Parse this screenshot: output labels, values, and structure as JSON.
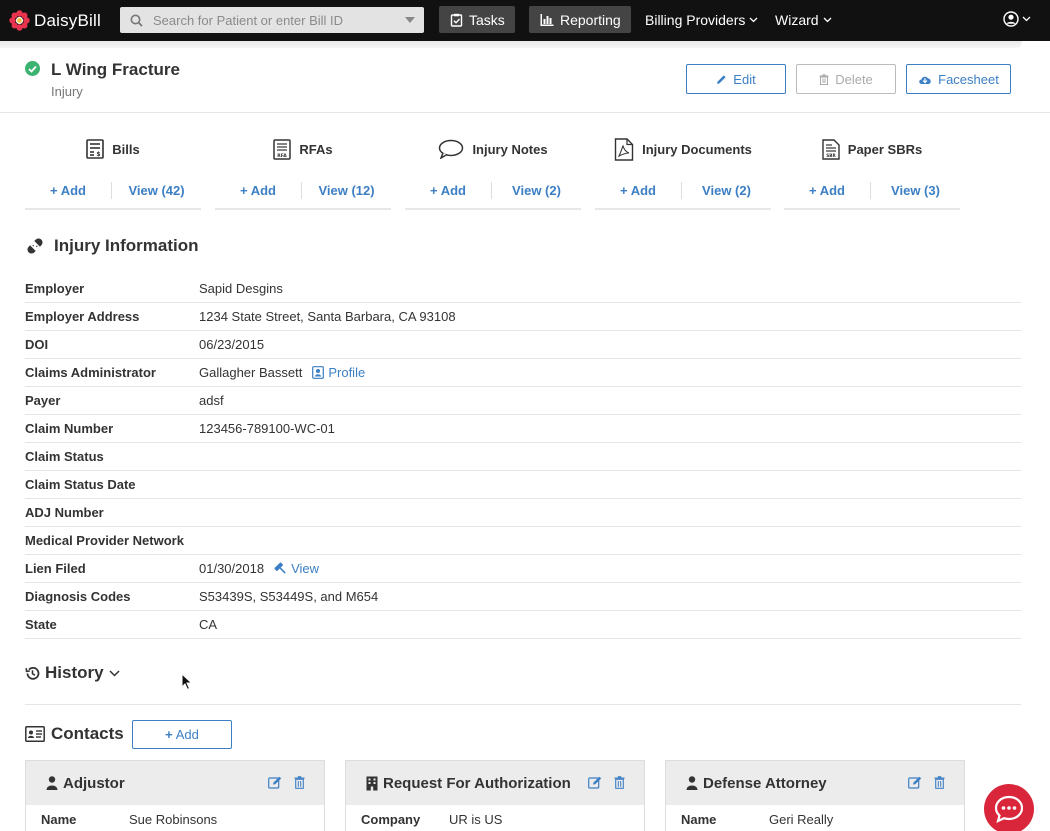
{
  "nav": {
    "logo_text": "DaisyBill",
    "search_placeholder": "Search for Patient or enter Bill ID",
    "tasks": "Tasks",
    "reporting": "Reporting",
    "billing_providers": "Billing Providers",
    "wizard": "Wizard"
  },
  "header": {
    "title": "L Wing Fracture",
    "subtitle": "Injury",
    "edit": "Edit",
    "delete": "Delete",
    "facesheet": "Facesheet"
  },
  "quick": [
    {
      "label": "Bills",
      "add": "Add",
      "view": "View (42)"
    },
    {
      "label": "RFAs",
      "add": "Add",
      "view": "View (12)"
    },
    {
      "label": "Injury Notes",
      "add": "Add",
      "view": "View (2)"
    },
    {
      "label": "Injury Documents",
      "add": "Add",
      "view": "View (2)"
    },
    {
      "label": "Paper SBRs",
      "add": "Add",
      "view": "View (3)"
    }
  ],
  "info": {
    "title": "Injury Information",
    "rows": [
      {
        "label": "Employer",
        "value": "Sapid Desgins"
      },
      {
        "label": "Employer Address",
        "value": "1234 State Street, Santa Barbara, CA 93108"
      },
      {
        "label": "DOI",
        "value": "06/23/2015"
      },
      {
        "label": "Claims Administrator",
        "value": "Gallagher Bassett",
        "link": "Profile"
      },
      {
        "label": "Payer",
        "value": "adsf"
      },
      {
        "label": "Claim Number",
        "value": "123456-789100-WC-01"
      },
      {
        "label": "Claim Status",
        "value": ""
      },
      {
        "label": "Claim Status Date",
        "value": ""
      },
      {
        "label": "ADJ Number",
        "value": ""
      },
      {
        "label": "Medical Provider Network",
        "value": ""
      },
      {
        "label": "Lien Filed",
        "value": "01/30/2018",
        "link": "View"
      },
      {
        "label": "Diagnosis Codes",
        "value": "S53439S, S53449S, and M654"
      },
      {
        "label": "State",
        "value": "CA"
      }
    ]
  },
  "history": {
    "title": "History"
  },
  "contacts": {
    "title": "Contacts",
    "add": "Add",
    "cards": [
      {
        "title": "Adjustor",
        "field": "Name",
        "value": "Sue Robinsons"
      },
      {
        "title": "Request For Authorization",
        "field": "Company",
        "value": "UR is US"
      },
      {
        "title": "Defense Attorney",
        "field": "Name",
        "value": "Geri Really"
      }
    ]
  },
  "colors": {
    "accent": "#3c7fc4",
    "success": "#3cb371",
    "chat": "#d9263a",
    "nav": "#111111"
  }
}
